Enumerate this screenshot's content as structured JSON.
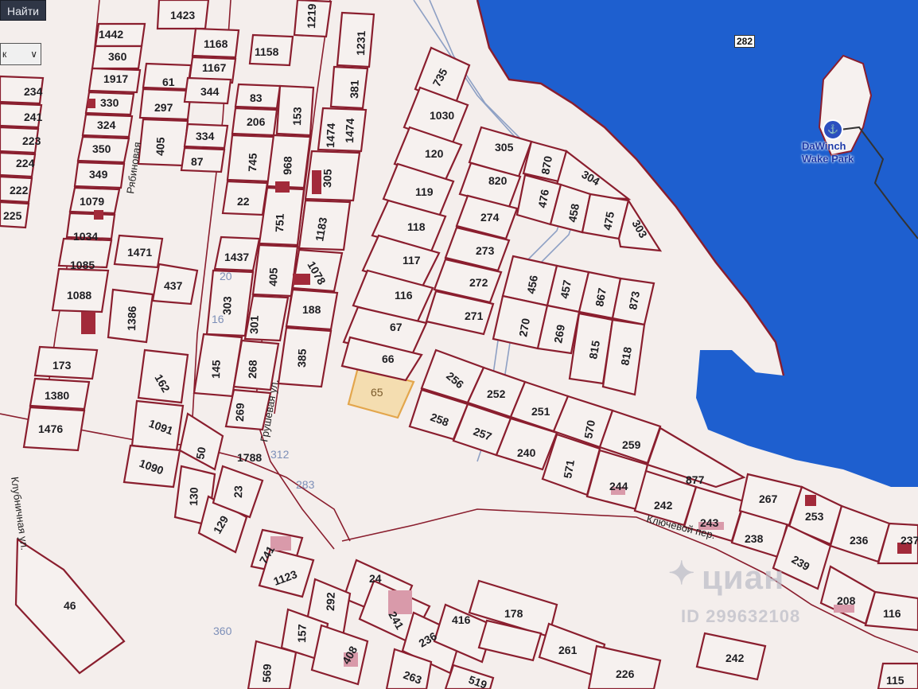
{
  "toolbar": {
    "find_button": "Найти",
    "select_value": "к"
  },
  "route_badge": "282",
  "poi": {
    "label": "DaWinch Wake Park",
    "icon": "wake-park-icon"
  },
  "watermark": {
    "brand": "циан",
    "id": "ID 299632108"
  },
  "colors": {
    "water": "#1e5fcf",
    "plot_border": "#8a1e2e",
    "highlight": "#e3a64c",
    "background": "#f4eeec"
  },
  "highlighted_plot": "65",
  "streets": [
    "Рябиновая",
    "Грушевая ул.",
    "Ключевой пер.",
    "Клубничная ул."
  ],
  "plot_numbers": [
    "735",
    "1030",
    "120",
    "119",
    "118",
    "117",
    "116",
    "67",
    "66",
    "65",
    "305",
    "870",
    "820",
    "304",
    "476",
    "458",
    "475",
    "303",
    "274",
    "273",
    "272",
    "271",
    "456",
    "457",
    "867",
    "873",
    "270",
    "269",
    "815",
    "818",
    "256",
    "252",
    "251",
    "570",
    "259",
    "258",
    "257",
    "240",
    "571",
    "244",
    "877",
    "242",
    "243",
    "238",
    "267",
    "253",
    "236",
    "237",
    "239",
    "208",
    "116",
    "1423",
    "1168",
    "1167",
    "1158",
    "1219",
    "1231",
    "381",
    "83",
    "206",
    "153",
    "1474",
    "1474",
    "305",
    "745",
    "968",
    "22",
    "751",
    "1183",
    "1437",
    "405",
    "1078",
    "188",
    "303",
    "301",
    "385",
    "145",
    "268",
    "269",
    "50",
    "130",
    "129",
    "23",
    "741",
    "1123",
    "1442",
    "360",
    "1917",
    "330",
    "324",
    "350",
    "349",
    "1079",
    "1034",
    "1085",
    "1088",
    "1471",
    "437",
    "1386",
    "173",
    "1380",
    "1476",
    "162",
    "1091",
    "1090",
    "234",
    "241",
    "223",
    "224",
    "222",
    "225",
    "297",
    "61",
    "344",
    "405",
    "334",
    "87",
    "46",
    "24",
    "241",
    "292",
    "157",
    "408",
    "236",
    "416",
    "178",
    "261",
    "226",
    "263",
    "519",
    "569",
    "242",
    "115",
    "1788",
    "24"
  ],
  "blue_labels": [
    "283",
    "312",
    "360",
    "20",
    "16"
  ]
}
